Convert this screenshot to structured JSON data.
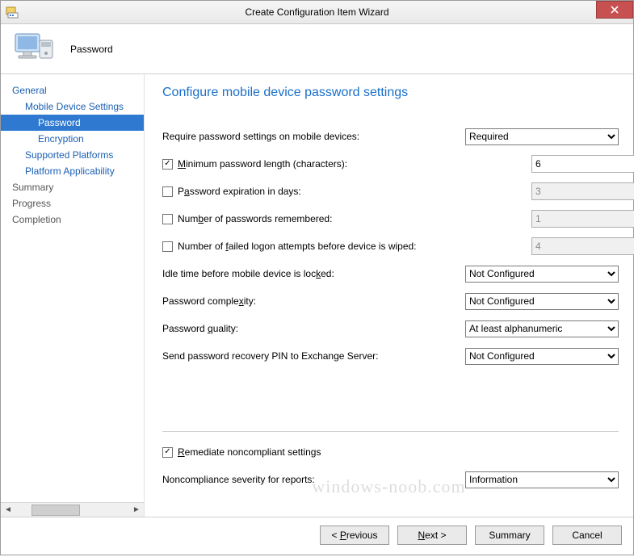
{
  "window": {
    "title": "Create Configuration Item Wizard"
  },
  "header": {
    "heading": "Password"
  },
  "sidebar": {
    "items": [
      {
        "label": "General",
        "level": 1
      },
      {
        "label": "Mobile Device Settings",
        "level": 2
      },
      {
        "label": "Password",
        "level": 3,
        "selected": true
      },
      {
        "label": "Encryption",
        "level": 3
      },
      {
        "label": "Supported Platforms",
        "level": 2
      },
      {
        "label": "Platform Applicability",
        "level": 2
      },
      {
        "label": "Summary",
        "level": 1,
        "muted": true
      },
      {
        "label": "Progress",
        "level": 1,
        "muted": true
      },
      {
        "label": "Completion",
        "level": 1,
        "muted": true
      }
    ]
  },
  "main": {
    "title": "Configure mobile device password settings",
    "labels": {
      "require": "Require password settings on mobile devices:",
      "minlen": "Minimum password length (characters):",
      "expire": "Password expiration in days:",
      "remembered": "Number of passwords remembered:",
      "failed": "Number of failed logon attempts before device is wiped:",
      "idle": "Idle time before mobile device is locked:",
      "complexity": "Password complexity:",
      "quality": "Password quality:",
      "recovery": "Send password recovery PIN to Exchange Server:",
      "remediate": "Remediate noncompliant settings",
      "severity": "Noncompliance severity for reports:"
    },
    "values": {
      "require": "Required",
      "minlen": "6",
      "expire": "3",
      "remembered": "1",
      "failed": "4",
      "idle": "Not Configured",
      "complexity": "Not Configured",
      "quality": "At least alphanumeric",
      "recovery": "Not Configured",
      "severity": "Information"
    },
    "checked": {
      "minlen": true,
      "expire": false,
      "remembered": false,
      "failed": false,
      "remediate": true
    }
  },
  "buttons": {
    "previous": "< Previous",
    "next": "Next >",
    "summary": "Summary",
    "cancel": "Cancel"
  },
  "watermark": "windows-noob.com"
}
